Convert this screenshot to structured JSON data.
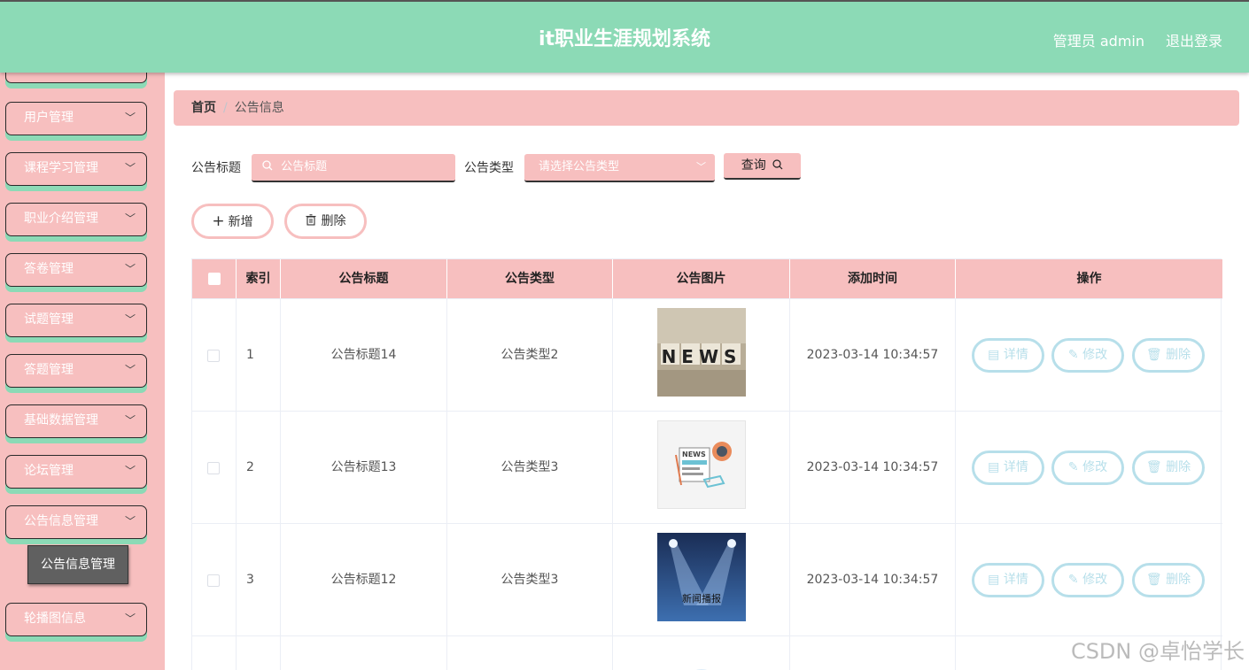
{
  "header": {
    "title": "it职业生涯规划系统",
    "user": "管理员 admin",
    "logout": "退出登录"
  },
  "sidebar": {
    "items": [
      {
        "label": ""
      },
      {
        "label": "用户管理"
      },
      {
        "label": "课程学习管理"
      },
      {
        "label": "职业介绍管理"
      },
      {
        "label": "答卷管理"
      },
      {
        "label": "试题管理"
      },
      {
        "label": "答题管理"
      },
      {
        "label": "基础数据管理"
      },
      {
        "label": "论坛管理"
      },
      {
        "label": "公告信息管理"
      },
      {
        "label": "轮播图信息"
      }
    ],
    "submenu_active": "公告信息管理"
  },
  "breadcrumb": {
    "home": "首页",
    "sep": "/",
    "current": "公告信息"
  },
  "search": {
    "title_label": "公告标题",
    "title_placeholder": "公告标题",
    "type_label": "公告类型",
    "type_placeholder": "请选择公告类型",
    "query_button": "查询"
  },
  "actions": {
    "add": "新增",
    "delete": "删除"
  },
  "table": {
    "headers": [
      "索引",
      "公告标题",
      "公告类型",
      "公告图片",
      "添加时间",
      "操作"
    ],
    "rows": [
      {
        "index": "1",
        "title": "公告标题14",
        "type": "公告类型2",
        "time": "2023-03-14 10:34:57",
        "image": "NEWS"
      },
      {
        "index": "2",
        "title": "公告标题13",
        "type": "公告类型3",
        "time": "2023-03-14 10:34:57",
        "image": "NEWS"
      },
      {
        "index": "3",
        "title": "公告标题12",
        "type": "公告类型3",
        "time": "2023-03-14 10:34:57",
        "image": "新闻播报"
      }
    ],
    "row_actions": {
      "detail": "详情",
      "edit": "修改",
      "delete": "删除"
    }
  },
  "watermark": "CSDN @卓怡学长",
  "colors": {
    "header": "#8cdab6",
    "accent": "#f7bfbf",
    "action": "#b7dfea"
  }
}
